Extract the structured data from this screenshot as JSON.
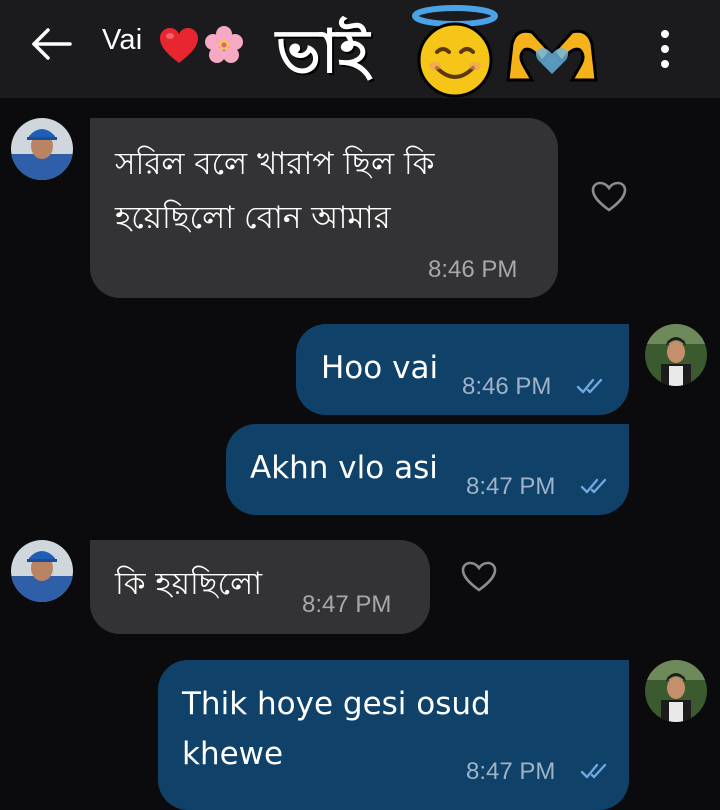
{
  "header": {
    "contact_name": "Vai",
    "sticker_text": "ভাই",
    "heart_emoji": "red-heart",
    "flower_emoji": "cherry-blossom",
    "halo_emoji": "smiling-face-with-halo",
    "hands_emoji": "heart-hands"
  },
  "colors": {
    "background": "#0b0b0d",
    "header": "#1b1b1e",
    "incoming_bubble": "#333335",
    "outgoing_bubble": "#0f4169",
    "read_ticks": "#6fa8dc"
  },
  "messages": [
    {
      "direction": "incoming",
      "lines": [
        "সরিল বলে খারাপ ছিল কি",
        "হয়েছিলো বোন আমার"
      ],
      "time": "8:46 PM"
    },
    {
      "direction": "outgoing",
      "lines": [
        "Hoo vai"
      ],
      "time": "8:46 PM",
      "status": "read"
    },
    {
      "direction": "outgoing",
      "lines": [
        "Akhn vlo asi"
      ],
      "time": "8:47 PM",
      "status": "read"
    },
    {
      "direction": "incoming",
      "lines": [
        "কি হয়ছিলো"
      ],
      "time": "8:47 PM"
    },
    {
      "direction": "outgoing",
      "lines": [
        "Thik hoye gesi osud",
        "khewe"
      ],
      "time": "8:47 PM",
      "status": "read"
    }
  ]
}
